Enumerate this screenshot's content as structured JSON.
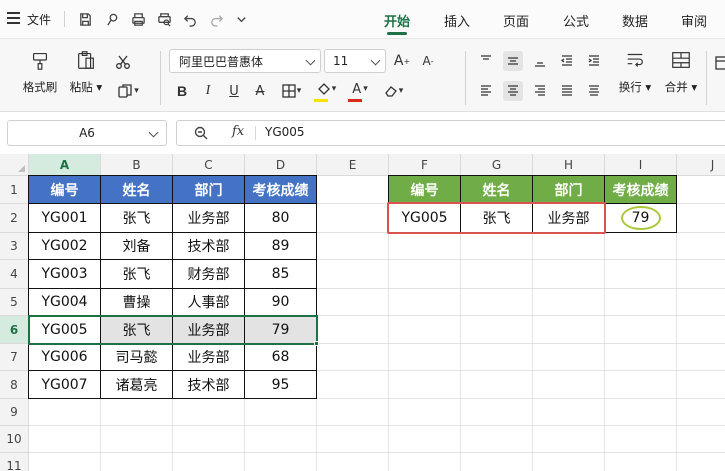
{
  "topbar": {
    "file_label": "文件",
    "tabs": [
      "开始",
      "插入",
      "页面",
      "公式",
      "数据",
      "审阅"
    ],
    "active_tab": "开始"
  },
  "ribbon": {
    "format_painter": "格式刷",
    "paste": "粘贴",
    "font_name": "阿里巴巴普惠体",
    "font_size": "11",
    "wrap": "换行",
    "merge": "合并",
    "font_color": "#d92a1c",
    "fill_color": "#f2e300"
  },
  "formula_bar": {
    "name_box": "A6",
    "fx": "fx",
    "value": "YG005"
  },
  "sheet": {
    "columns": [
      "A",
      "B",
      "C",
      "D",
      "E",
      "F",
      "G",
      "H",
      "I",
      "J"
    ],
    "rows": [
      "1",
      "2",
      "3",
      "4",
      "5",
      "6",
      "7",
      "8",
      "9",
      "10",
      "11"
    ],
    "selected_column": "A",
    "selected_row": "6"
  },
  "main_table": {
    "headers": [
      "编号",
      "姓名",
      "部门",
      "考核成绩"
    ],
    "rows": [
      [
        "YG001",
        "张飞",
        "业务部",
        "80"
      ],
      [
        "YG002",
        "刘备",
        "技术部",
        "89"
      ],
      [
        "YG003",
        "张飞",
        "财务部",
        "85"
      ],
      [
        "YG004",
        "曹操",
        "人事部",
        "90"
      ],
      [
        "YG005",
        "张飞",
        "业务部",
        "79"
      ],
      [
        "YG006",
        "司马懿",
        "业务部",
        "68"
      ],
      [
        "YG007",
        "诸葛亮",
        "技术部",
        "95"
      ]
    ],
    "header_color": "#4472c4",
    "highlight_row": 5
  },
  "lookup_table": {
    "headers": [
      "编号",
      "姓名",
      "部门",
      "考核成绩"
    ],
    "row": [
      "YG005",
      "张飞",
      "业务部",
      "79"
    ],
    "header_color": "#70ad47",
    "highlight_box_color": "#d9534f",
    "circle_color": "#a8c83a"
  }
}
